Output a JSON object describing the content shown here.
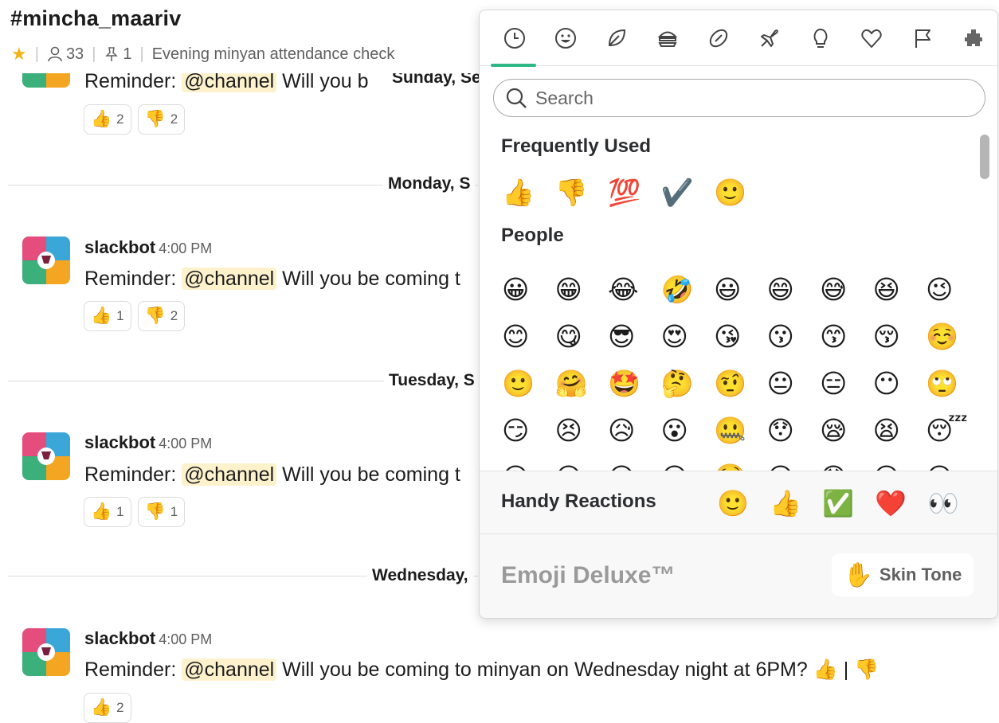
{
  "channel": {
    "name": "#mincha_maariv",
    "member_count": "33",
    "pinned_count": "1",
    "topic": "Evening minyan attendance check"
  },
  "messages": [
    {
      "sender": "",
      "time": "",
      "prefix": "Reminder: ",
      "mention": "@channel",
      "text": " Will you b",
      "reactions": [
        {
          "emoji": "👍",
          "count": "2"
        },
        {
          "emoji": "👎",
          "count": "2"
        }
      ]
    },
    {
      "sender": "slackbot",
      "time": "4:00 PM",
      "prefix": "Reminder: ",
      "mention": "@channel",
      "text": " Will you be coming t",
      "reactions": [
        {
          "emoji": "👍",
          "count": "1"
        },
        {
          "emoji": "👎",
          "count": "2"
        }
      ]
    },
    {
      "sender": "slackbot",
      "time": "4:00 PM",
      "prefix": "Reminder: ",
      "mention": "@channel",
      "text": " Will you be coming t",
      "reactions": [
        {
          "emoji": "👍",
          "count": "1"
        },
        {
          "emoji": "👎",
          "count": "1"
        }
      ]
    },
    {
      "sender": "slackbot",
      "time": "4:00 PM",
      "prefix": "Reminder: ",
      "mention": "@channel",
      "text": " Will you be coming to minyan on Wednesday night at 6PM? 👍 | 👎",
      "reactions": [
        {
          "emoji": "👍",
          "count": "2"
        }
      ]
    }
  ],
  "date_dividers": [
    "Sunday, Se",
    "Monday, S",
    "Tuesday, S",
    "Wednesday,"
  ],
  "picker": {
    "category_icons": [
      "clock-icon",
      "smiley-icon",
      "leaf-icon",
      "burger-icon",
      "football-icon",
      "airplane-icon",
      "lightbulb-icon",
      "heart-icon",
      "flag-icon",
      "custom-icon"
    ],
    "search_placeholder": "Search",
    "frequently_used_title": "Frequently Used",
    "frequently_used": [
      "👍",
      "👎",
      "💯",
      "✔️",
      "🙂"
    ],
    "people_title": "People",
    "people_rows": [
      [
        "😀",
        "😁",
        "😂",
        "🤣",
        "😃",
        "😄",
        "😅",
        "😆",
        "😉"
      ],
      [
        "😊",
        "😋",
        "😎",
        "😍",
        "😘",
        "😗",
        "😙",
        "😚",
        "☺️"
      ],
      [
        "🙂",
        "🤗",
        "🤩",
        "🤔",
        "🤨",
        "😐",
        "😑",
        "😶",
        "🙄"
      ],
      [
        "😏",
        "😣",
        "😥",
        "😮",
        "🤐",
        "😯",
        "😪",
        "😫",
        "😴"
      ],
      [
        "😌",
        "😛",
        "😜",
        "😝",
        "🤤",
        "😒",
        "😓",
        "😔",
        "😕"
      ]
    ],
    "handy_label": "Handy Reactions",
    "handy_emojis": [
      "🙂",
      "👍",
      "✅",
      "❤️",
      "👀"
    ],
    "deluxe_label": "Emoji Deluxe™",
    "skin_tone_emoji": "✋",
    "skin_tone_label": "Skin Tone"
  }
}
